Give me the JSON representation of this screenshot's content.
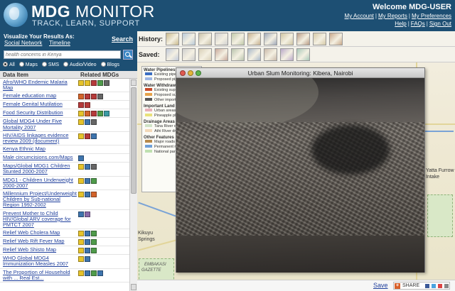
{
  "header": {
    "logo_bold": "MDG",
    "logo_light": " MONITOR",
    "tagline": "TRACK, LEARN, SUPPORT",
    "welcome": "Welcome MDG-USER",
    "links_row1": [
      "My Account",
      "My Reports",
      "My Preferences"
    ],
    "links_row2": [
      "Help",
      "FAQs",
      "Sign Out"
    ],
    "separator": "|"
  },
  "visualize": {
    "title": "Visualize Your Results As:",
    "options": [
      "Social Network",
      "Timeline"
    ],
    "search_label": "Search",
    "search_placeholder": "health concerns in Kenya",
    "radio_options": [
      "All",
      "Maps",
      "SMS",
      "Audio/Video",
      "Blogs"
    ],
    "radio_selected": "All"
  },
  "list": {
    "header_item": "Data Item",
    "header_related": "Related MDGs",
    "items": [
      {
        "label": "Afro/WHO Endemic Malaria Map",
        "icons": [
          "y",
          "y",
          "r",
          "g",
          "k"
        ]
      },
      {
        "label": "Female education map",
        "icons": [
          "o",
          "r",
          "r",
          "k"
        ]
      },
      {
        "label": "Female Genital Mutilation",
        "icons": [
          "r",
          "r"
        ]
      },
      {
        "label": "Food Security Distribution",
        "icons": [
          "y",
          "o",
          "r",
          "g",
          "t"
        ]
      },
      {
        "label": "Global MDG4 Under Five Mortality 2007",
        "icons": [
          "y",
          "b",
          "k"
        ]
      },
      {
        "label": "HIV/AIDS linkages evidence review 2009 (document)",
        "icons": [
          "y",
          "r",
          "b"
        ]
      },
      {
        "label": "Kenya Ethnic Map",
        "icons": []
      },
      {
        "label": "Male circumcisions.com/Maps",
        "icons": [
          "b"
        ]
      },
      {
        "label": "Maps/Global MDG1 Children Stunted 2000-2007",
        "icons": [
          "y",
          "b",
          "k"
        ]
      },
      {
        "label": "MDG1 - Children Underweight 2000-2007",
        "icons": [
          "y",
          "b",
          "g"
        ]
      },
      {
        "label": "Millennium Project/Underweight Children by Sub-national Region 1992-2002",
        "icons": [
          "y",
          "b",
          "o"
        ]
      },
      {
        "label": "Prevent Mother to Child HIV/Global ARV coverage for PMTCT 2007",
        "icons": [
          "b",
          "p"
        ]
      },
      {
        "label": "Relief Web Cholera Map",
        "icons": [
          "y",
          "b",
          "g"
        ]
      },
      {
        "label": "Relief Web Rift Fever Map",
        "icons": [
          "y",
          "b",
          "g"
        ]
      },
      {
        "label": "Relief Web Shisto Map",
        "icons": [
          "y",
          "b",
          "g"
        ]
      },
      {
        "label": "WHO Global MDG4 Immunization Measles 2007",
        "icons": [
          "y",
          "b"
        ]
      },
      {
        "label": "The Proportion of Household with ... Real Est...",
        "icons": [
          "y",
          "b",
          "g",
          "b"
        ]
      }
    ]
  },
  "map": {
    "history_label": "History:",
    "saved_label": "Saved:",
    "history_thumbs": [
      "#c9b98a",
      "#b8c9d9",
      "#c8c0a8",
      "#d0d0d0",
      "#bfc8a8",
      "#c7b18f",
      "#9ea8b9",
      "#cfc4a2",
      "#b89a84",
      "#d5c9a7",
      "#c9a98a"
    ],
    "saved_thumbs": [
      "#c0c9d9",
      "#cfcfcf",
      "#d9d0b8",
      "#c8a89a",
      "#b9c4ad",
      "#a9b8c9",
      "#c9b9a9",
      "#b9a9c9",
      "#a9c9b9"
    ],
    "labels": {
      "yatta": "Yatta Furrow",
      "intake": "Intake",
      "kikuyu": "Kikuyu",
      "springs": "Springs",
      "embakasi": "EMBAKASI",
      "embakasi2": "GAZETTE"
    },
    "legend": [
      {
        "section": "Water Pipelines",
        "rows": [
          "Existing pipeline",
          "Proposed pipeline"
        ]
      },
      {
        "section": "Water Withdraw S",
        "rows": [
          "Existing supply a",
          "Proposed supply",
          "Other important"
        ]
      },
      {
        "section": "Important Land C",
        "rows": [
          "Urban areas",
          "Pineapple plantati"
        ]
      },
      {
        "section": "Drainage Areas",
        "rows": [
          "Tana River draina",
          "Athi River draina"
        ]
      },
      {
        "section": "Other Features",
        "rows": [
          "Major roads",
          "Permanent rivers",
          "National parks and"
        ]
      }
    ],
    "legend_colors": [
      "#3b6ec2",
      "#9db6e4",
      "#c74a2a",
      "#e6a34a",
      "#555",
      "#e8b0b8",
      "#e9e17a",
      "#cfe3c6",
      "#f2d8b8",
      "#b88a4a",
      "#6fa0d8",
      "#bfe0b0"
    ]
  },
  "popup": {
    "title": "Urban Slum Monitoring: Kibera, Nairobi"
  },
  "bottom": {
    "save": "Save",
    "share": "SHARE"
  }
}
